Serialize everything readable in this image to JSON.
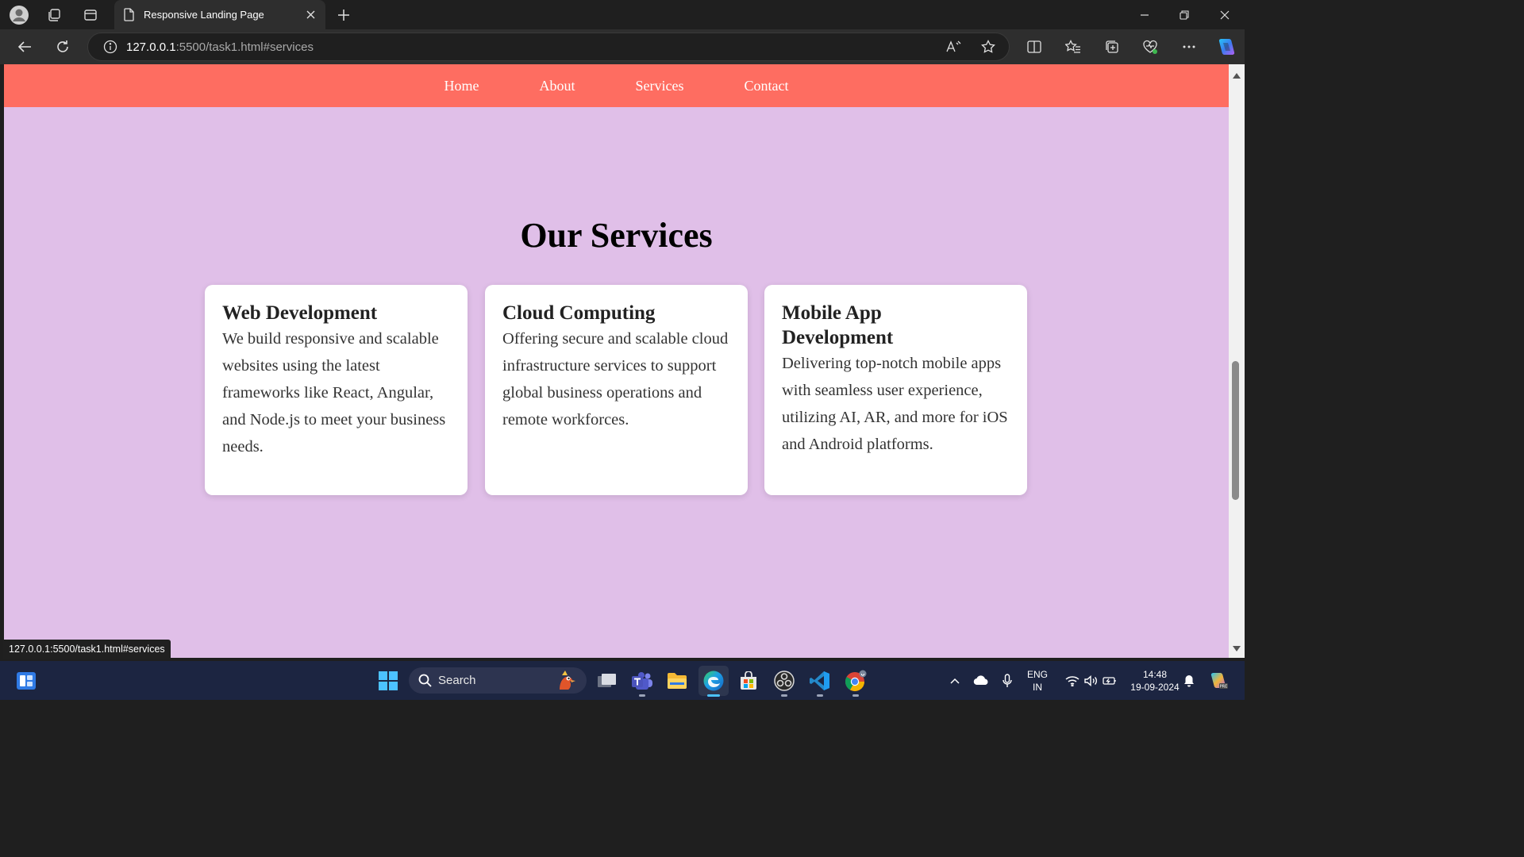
{
  "browser": {
    "tab": {
      "title": "Responsive Landing Page"
    },
    "address": {
      "host": "127.0.0.1",
      "rest": ":5500/task1.html#services"
    },
    "status_url": "127.0.0.1:5500/task1.html#services"
  },
  "page": {
    "nav": [
      "Home",
      "About",
      "Services",
      "Contact"
    ],
    "section_title": "Our Services",
    "cards": [
      {
        "title": "Web Development",
        "text": "We build responsive and scalable websites using the latest frameworks like React, Angular, and Node.js to meet your business needs."
      },
      {
        "title": "Cloud Computing",
        "text": "Offering secure and scalable cloud infrastructure services to support global business operations and remote workforces."
      },
      {
        "title": "Mobile App Development",
        "text": "Delivering top-notch mobile apps with seamless user experience, utilizing AI, AR, and more for iOS and Android platforms."
      }
    ],
    "colors": {
      "navbar": "#fe6d61",
      "background": "#e0bfe8",
      "card": "#ffffff"
    }
  },
  "taskbar": {
    "search_label": "Search",
    "language": {
      "line1": "ENG",
      "line2": "IN"
    },
    "clock": {
      "time": "14:48",
      "date": "19-09-2024"
    },
    "icons": [
      "widgets-icon",
      "windows-start-icon",
      "search-icon",
      "task-view-icon",
      "teams-icon",
      "file-explorer-icon",
      "edge-icon",
      "microsoft-store-icon",
      "obs-icon",
      "vscode-icon",
      "chrome-icon"
    ]
  }
}
